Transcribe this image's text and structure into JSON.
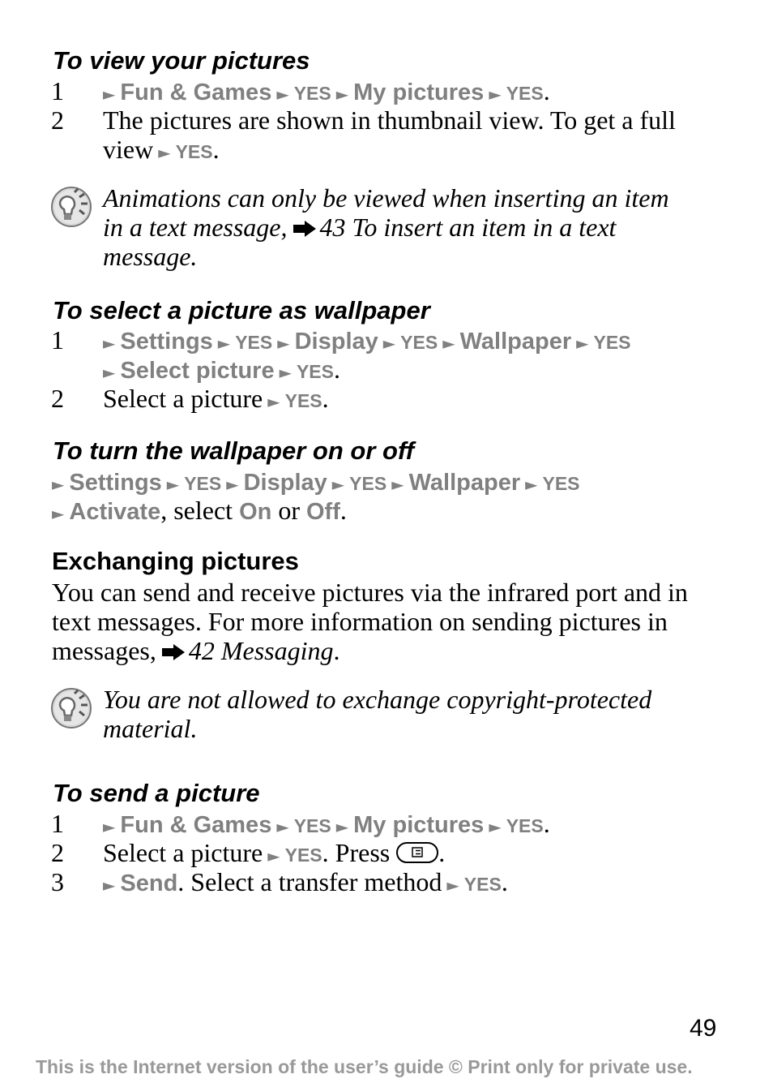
{
  "sections": {
    "view_pictures": {
      "heading": "To view your pictures",
      "step1": {
        "num": "1",
        "items": [
          "Fun & Games",
          "YES",
          "My pictures",
          "YES"
        ],
        "end": "."
      },
      "step2": {
        "num": "2",
        "text_line1": "The pictures are shown in thumbnail view. To get a full",
        "text_line2": "view",
        "yes": "YES",
        "end": "."
      }
    },
    "note_animations": {
      "icon": "lightbulb-tip-icon",
      "line1": "Animations can only be viewed when inserting an item",
      "line2_pre": "in a text message,",
      "ref_icon": "reference-arrow-icon",
      "line2_ref": "43 To insert an item in a text",
      "line3": "message."
    },
    "select_wallpaper": {
      "heading": "To select a picture as wallpaper",
      "step1": {
        "num": "1",
        "items_line1": [
          "Settings",
          "YES",
          "Display",
          "YES",
          "Wallpaper",
          "YES"
        ],
        "items_line2": [
          "Select picture",
          "YES"
        ],
        "end": "."
      },
      "step2": {
        "num": "2",
        "text": "Select a picture",
        "yes": "YES",
        "end": "."
      }
    },
    "wallpaper_onoff": {
      "heading": "To turn the wallpaper on or off",
      "items_line1": [
        "Settings",
        "YES",
        "Display",
        "YES",
        "Wallpaper",
        "YES"
      ],
      "line2_cmd": "Activate",
      "line2_mid": ", select ",
      "line2_on": "On",
      "line2_or": " or ",
      "line2_off": "Off",
      "end": "."
    },
    "exchanging": {
      "heading": "Exchanging pictures",
      "line1": "You can send and receive pictures via the infrared port and in",
      "line2": "text messages. For more information on sending pictures in",
      "line3_pre": "messages,",
      "line3_ref": "42 Messaging",
      "end": "."
    },
    "note_copyright": {
      "icon": "lightbulb-tip-icon",
      "line1": "You are not allowed to exchange copyright-protected",
      "line2": "material."
    },
    "send_picture": {
      "heading": "To send a picture",
      "step1": {
        "num": "1",
        "items": [
          "Fun & Games",
          "YES",
          "My pictures",
          "YES"
        ],
        "end": "."
      },
      "step2": {
        "num": "2",
        "text": "Select a picture",
        "yes": "YES",
        "mid": ". Press",
        "key_icon": "options-key-icon",
        "end": "."
      },
      "step3": {
        "num": "3",
        "cmd": "Send",
        "text": ". Select a transfer method",
        "yes": "YES",
        "end": "."
      }
    }
  },
  "page_number": "49",
  "footer": "This is the Internet version of the user’s guide © Print only for private use.",
  "arrow_glyph": "►"
}
